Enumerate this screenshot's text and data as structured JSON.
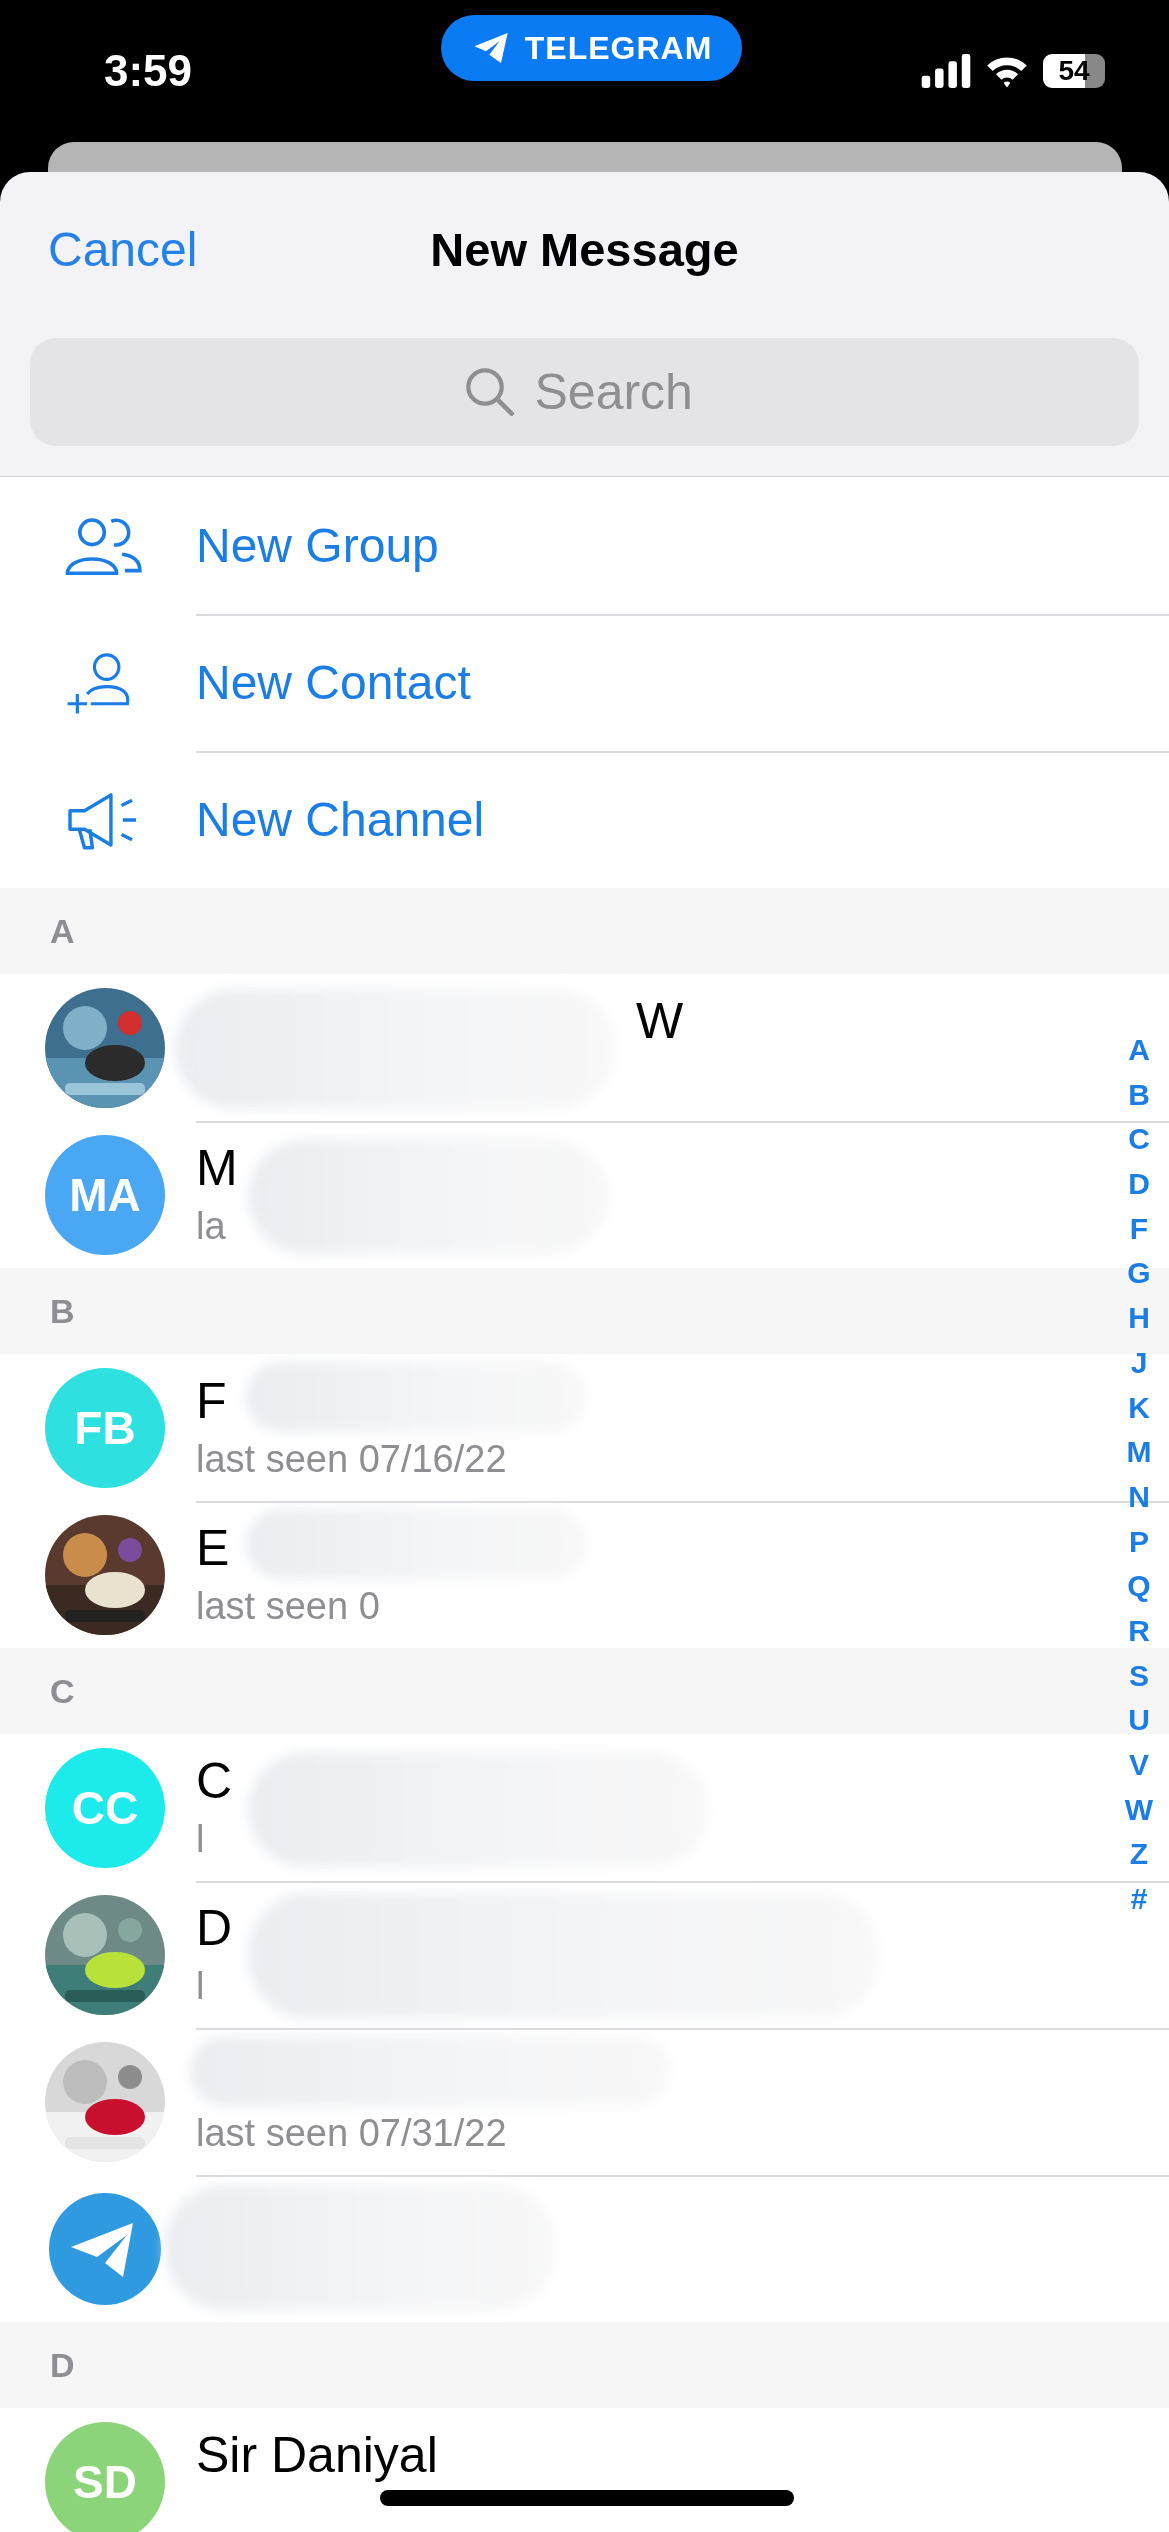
{
  "status_bar": {
    "time": "3:59",
    "app_pill": "TELEGRAM",
    "battery": "54"
  },
  "header": {
    "cancel": "Cancel",
    "title": "New Message"
  },
  "search": {
    "placeholder": "Search"
  },
  "actions": [
    {
      "kind": "group",
      "label": "New Group"
    },
    {
      "kind": "contact",
      "label": "New Contact"
    },
    {
      "kind": "channel",
      "label": "New Channel"
    }
  ],
  "sections": [
    {
      "letter": "A",
      "contacts": [
        {
          "name_end": "W",
          "redacted": true
        },
        {
          "kind": "initials",
          "initials": "MA",
          "color": "#4aa7f4",
          "name": "M",
          "status": "la",
          "redacted": true
        }
      ]
    },
    {
      "letter": "B",
      "contacts": [
        {
          "kind": "initials",
          "initials": "FB",
          "color": "#2fe0e0",
          "name": "F",
          "status": "last seen 07/16/22",
          "redacted": true
        },
        {
          "name": "E",
          "status": "last seen 0",
          "redacted": true
        }
      ]
    },
    {
      "letter": "C",
      "contacts": [
        {
          "kind": "initials",
          "initials": "CC",
          "color": "#1deaea",
          "name": "C",
          "status": "l",
          "redacted": true
        },
        {
          "name": "D",
          "status": "l",
          "redacted": true
        },
        {
          "status": "last seen 07/31/22",
          "redacted": true
        },
        {
          "kind": "logo",
          "redacted": true
        }
      ]
    },
    {
      "letter": "D",
      "contacts": [
        {
          "kind": "initials",
          "initials": "SD",
          "color": "#8cd47a",
          "name": "Sir Daniyal",
          "redacted": false
        }
      ]
    }
  ],
  "index": [
    "A",
    "B",
    "C",
    "D",
    "F",
    "G",
    "H",
    "J",
    "K",
    "M",
    "N",
    "P",
    "Q",
    "R",
    "S",
    "U",
    "V",
    "W",
    "Z",
    "#"
  ]
}
